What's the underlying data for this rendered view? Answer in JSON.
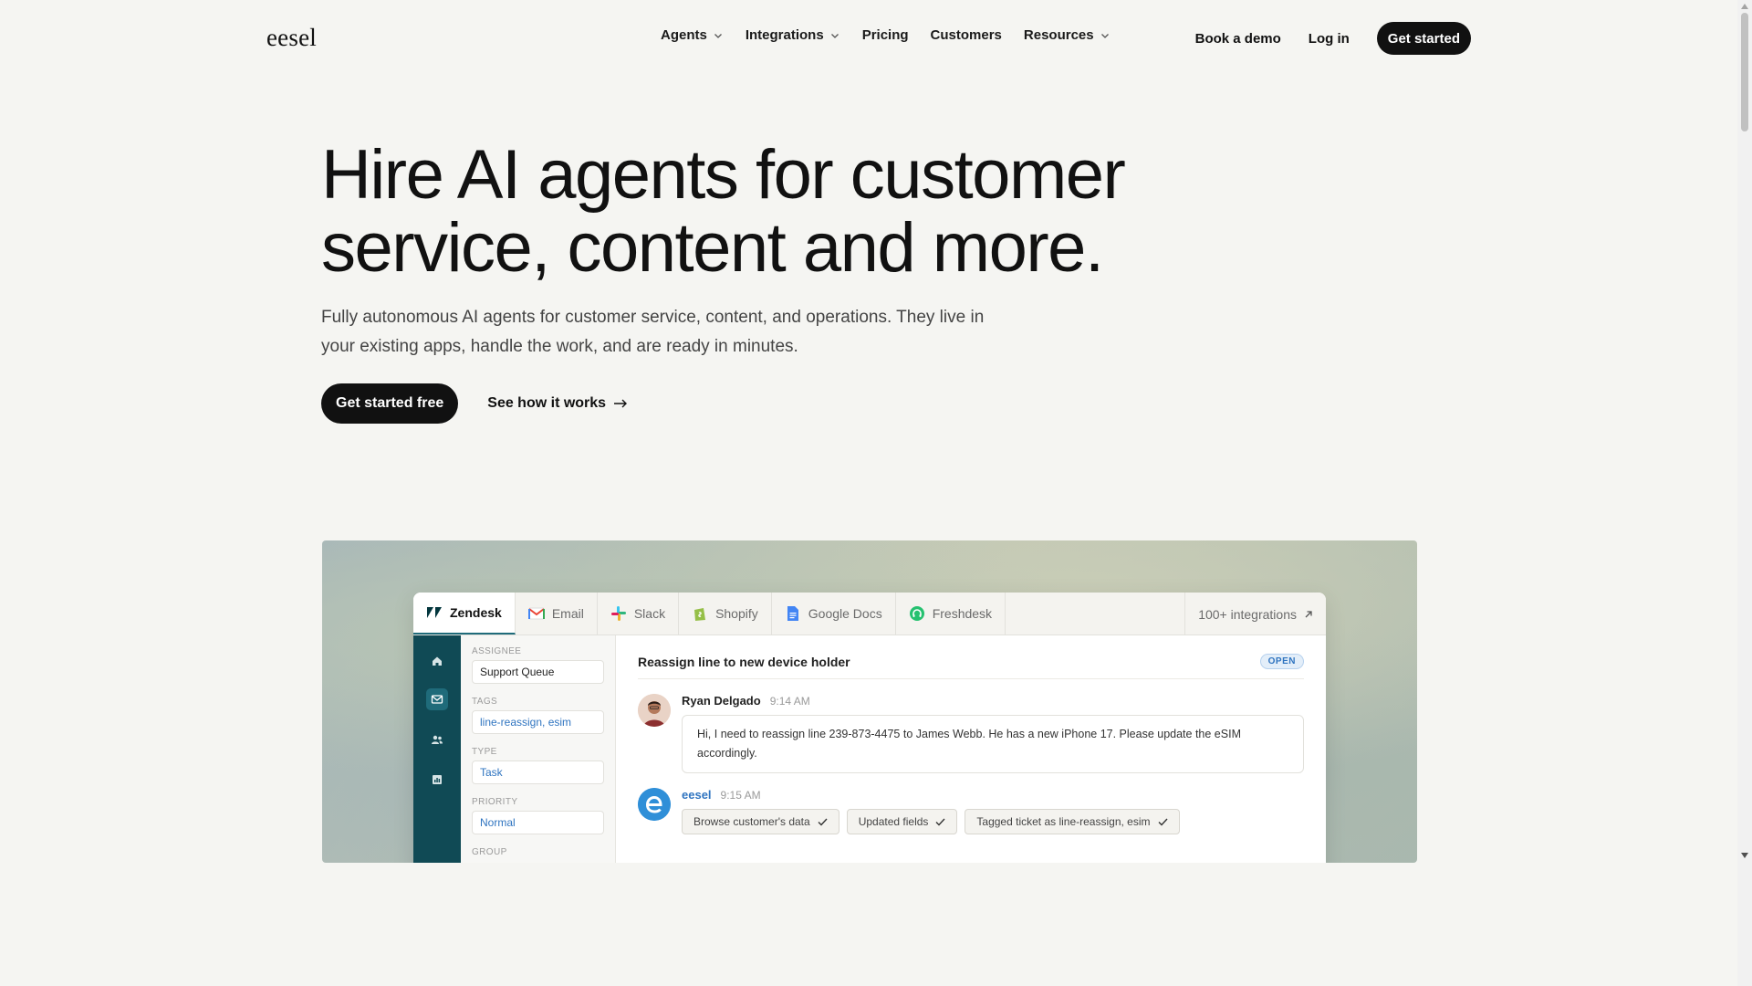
{
  "header": {
    "logo": "eesel",
    "nav": [
      {
        "label": "Agents",
        "dropdown": true
      },
      {
        "label": "Integrations",
        "dropdown": true
      },
      {
        "label": "Pricing",
        "dropdown": false
      },
      {
        "label": "Customers",
        "dropdown": false
      },
      {
        "label": "Resources",
        "dropdown": true
      }
    ],
    "book_demo": "Book a demo",
    "login": "Log in",
    "get_started": "Get started"
  },
  "hero": {
    "title_line1": "Hire AI agents for customer",
    "title_line2": "service, content and more.",
    "subtitle": "Fully autonomous AI agents for customer service, content, and operations. They live in your existing apps, handle the work, and are ready in minutes.",
    "cta_primary": "Get started free",
    "cta_secondary": "See how it works"
  },
  "demo": {
    "tabs": [
      {
        "label": "Zendesk",
        "icon": "zendesk-icon",
        "active": true
      },
      {
        "label": "Email",
        "icon": "gmail-icon",
        "active": false
      },
      {
        "label": "Slack",
        "icon": "slack-icon",
        "active": false
      },
      {
        "label": "Shopify",
        "icon": "shopify-icon",
        "active": false
      },
      {
        "label": "Google Docs",
        "icon": "google-docs-icon",
        "active": false
      },
      {
        "label": "Freshdesk",
        "icon": "freshdesk-icon",
        "active": false
      }
    ],
    "more_integrations": "100+ integrations",
    "fields": {
      "assignee_label": "ASSIGNEE",
      "assignee_value": "Support Queue",
      "tags_label": "TAGS",
      "tags_value": "line-reassign, esim",
      "type_label": "TYPE",
      "type_value": "Task",
      "priority_label": "PRIORITY",
      "priority_value": "Normal",
      "group_label": "GROUP"
    },
    "ticket": {
      "title": "Reassign line to new device holder",
      "status": "OPEN",
      "messages": [
        {
          "author": "Ryan Delgado",
          "time": "9:14 AM",
          "text_line1": "Hi, I need to reassign line 239-873-4475 to James Webb. He has a new iPhone 17. Please update the eSIM",
          "text_line2": "accordingly."
        },
        {
          "author": "eesel",
          "time": "9:15 AM",
          "chips": [
            "Browse customer's data",
            "Updated fields",
            "Tagged ticket as line-reassign, esim"
          ]
        }
      ]
    }
  },
  "colors": {
    "background": "#f5f5f2",
    "dark_button": "#111111",
    "sidebar_teal": "#104a55",
    "link_blue": "#2f74c0"
  }
}
